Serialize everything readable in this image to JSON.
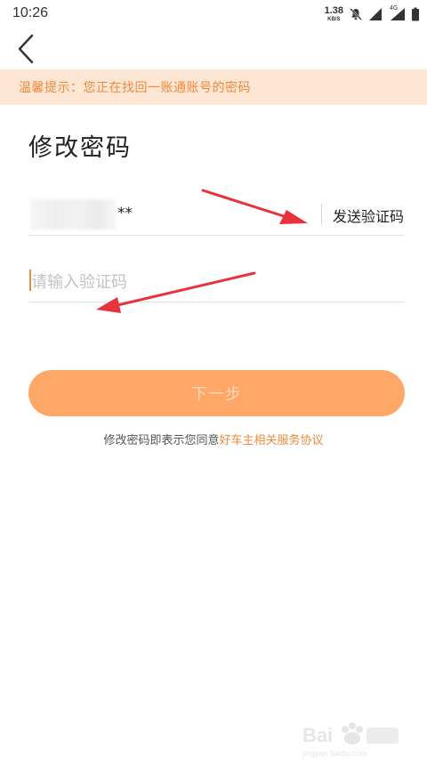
{
  "status_bar": {
    "time": "10:26",
    "net_speed_value": "1.38",
    "net_speed_unit": "KB/S",
    "net_type": "4G",
    "icons": [
      "mute-icon",
      "signal-icon",
      "signal-4g-icon",
      "battery-icon"
    ]
  },
  "nav": {
    "back_icon": "chevron-left-icon"
  },
  "tip": {
    "text": "温馨提示：您正在找回一账通账号的密码"
  },
  "page_title": "修改密码",
  "account": {
    "masked_suffix": "**",
    "send_code_label": "发送验证码"
  },
  "code_input": {
    "value": "",
    "placeholder": "请输入验证码"
  },
  "next_button": {
    "label": "下一步"
  },
  "agreement": {
    "prefix": "修改密码即表示您同意",
    "link": "好车主相关服务协议"
  },
  "colors": {
    "accent": "#f08a3c",
    "tip_background": "#fde6d3",
    "button_background": "#ffa766",
    "button_text": "#fcd8bd",
    "annotation_arrow": "#e8323c"
  }
}
